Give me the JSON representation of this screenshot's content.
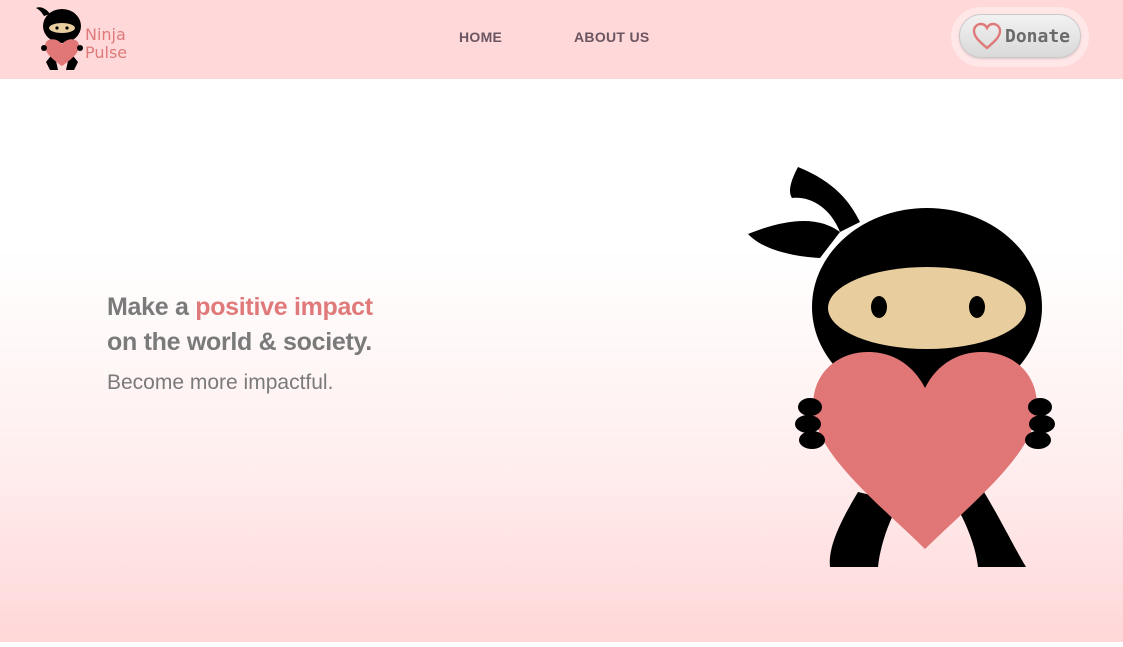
{
  "brand": {
    "line1": "Ninja",
    "line2": "Pulse"
  },
  "nav": {
    "home": "HOME",
    "about": "ABOUT US"
  },
  "donate": {
    "label": "Donate",
    "icon": "heart-outline-icon"
  },
  "hero": {
    "headline_prefix": "Make a ",
    "headline_highlight": "positive impact",
    "headline_line2": "on the world & society.",
    "subheadline": "Become more impactful."
  },
  "colors": {
    "accent": "#e07a7a",
    "navbar_bg": "#ffd8d9",
    "text_gray": "#7a7a7a"
  }
}
